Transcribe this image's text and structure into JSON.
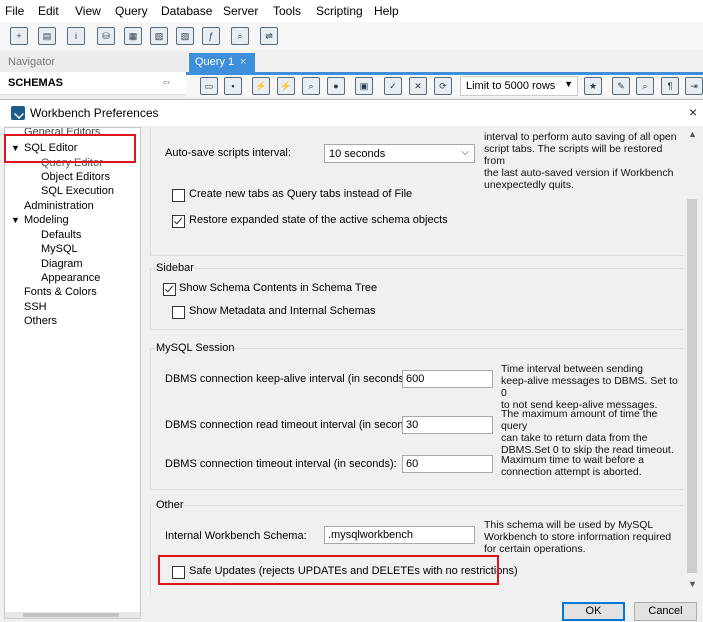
{
  "menubar": {
    "items": [
      "File",
      "Edit",
      "View",
      "Query",
      "Database",
      "Server",
      "Tools",
      "Scripting",
      "Help"
    ]
  },
  "navigator": {
    "title": "Navigator",
    "schemas_label": "SCHEMAS"
  },
  "query_tab": {
    "label": "Query 1",
    "close": "×"
  },
  "query_toolbar": {
    "limit_label": "Limit to 5000 rows"
  },
  "dialog": {
    "title": "Workbench Preferences",
    "close": "×",
    "tree": {
      "general_editors": "General Editors",
      "sql_editor": "SQL Editor",
      "query_editor": "Query Editor",
      "object_editors": "Object Editors",
      "sql_execution": "SQL Execution",
      "administration": "Administration",
      "modeling": "Modeling",
      "defaults": "Defaults",
      "mysql": "MySQL",
      "diagram": "Diagram",
      "appearance": "Appearance",
      "fonts_colors": "Fonts & Colors",
      "ssh": "SSH",
      "others": "Others"
    },
    "autosave": {
      "label": "Auto-save scripts interval:",
      "value": "10 seconds",
      "help": [
        "interval to perform auto saving of all open",
        "script tabs. The scripts will be restored from",
        "the last auto-saved version if Workbench",
        "unexpectedly quits."
      ]
    },
    "create_tabs_as_query": {
      "label": "Create new tabs as Query tabs instead of File",
      "checked": false
    },
    "restore_expanded": {
      "label": "Restore expanded state of the active schema objects",
      "checked": true
    },
    "sidebar": {
      "title": "Sidebar",
      "show_schema_contents": {
        "label": "Show Schema Contents in Schema Tree",
        "checked": true
      },
      "show_metadata": {
        "label": "Show Metadata and Internal Schemas",
        "checked": false
      }
    },
    "mysql_session": {
      "title": "MySQL Session",
      "keepalive": {
        "label": "DBMS connection keep-alive interval (in seconds):",
        "value": "600",
        "help": [
          "Time interval between sending",
          "keep-alive messages to DBMS. Set to 0",
          "to not send keep-alive messages."
        ]
      },
      "read_timeout": {
        "label": "DBMS connection read timeout interval (in seconds):",
        "value": "30",
        "help": [
          "The maximum amount of time the query",
          "can take to return data from the",
          "DBMS.Set 0 to skip the read timeout."
        ]
      },
      "conn_timeout": {
        "label": "DBMS connection timeout interval (in seconds):",
        "value": "60",
        "help": [
          "Maximum time to wait before a",
          "connection attempt is aborted."
        ]
      }
    },
    "other": {
      "title": "Other",
      "internal_schema": {
        "label": "Internal Workbench Schema:",
        "value": ".mysqlworkbench",
        "help": [
          "This schema will be used by MySQL",
          "Workbench to store information required",
          "for certain operations."
        ]
      },
      "safe_updates": {
        "label": "Safe Updates (rejects UPDATEs and DELETEs with no restrictions)",
        "checked": false
      }
    },
    "buttons": {
      "ok": "OK",
      "cancel": "Cancel"
    }
  },
  "colors": {
    "accent_tab": "#3d8fdc",
    "highlight": "#e0141e"
  }
}
